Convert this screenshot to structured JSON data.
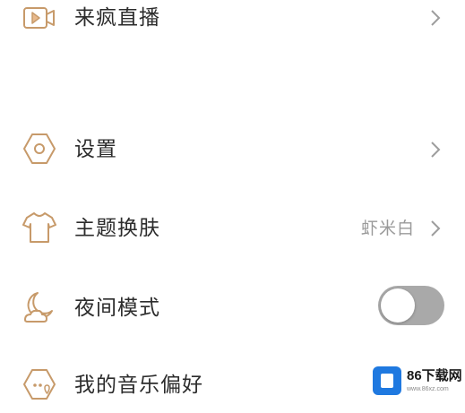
{
  "accent_color": "#c79a6a",
  "menu": {
    "items": [
      {
        "label": "来疯直播",
        "icon": "video-play-icon",
        "chevron": true
      },
      {
        "label": "设置",
        "icon": "settings-hexagon-icon",
        "chevron": true
      },
      {
        "label": "主题换肤",
        "icon": "tshirt-icon",
        "value": "虾米白",
        "chevron": true
      },
      {
        "label": "夜间模式",
        "icon": "moon-cloud-icon",
        "toggle": {
          "on": false
        }
      },
      {
        "label": "我的音乐偏好",
        "icon": "music-preference-icon"
      }
    ]
  },
  "watermark": {
    "title": "86下载网",
    "subtitle": "www.86xz.com"
  }
}
